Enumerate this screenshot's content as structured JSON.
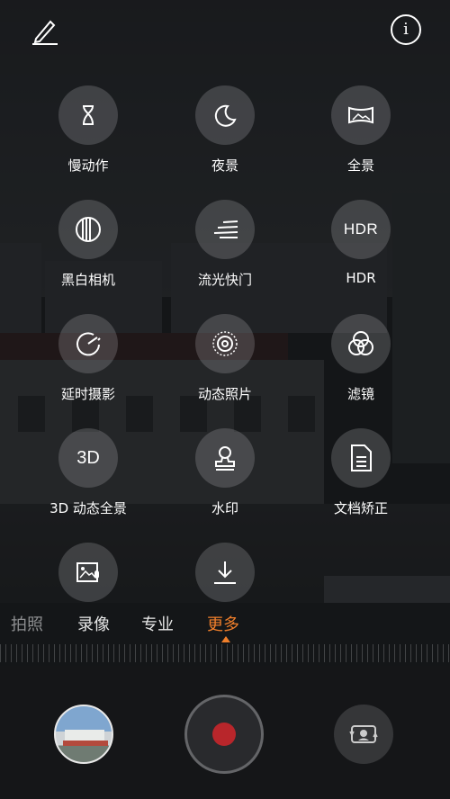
{
  "modes": [
    {
      "label": "慢动作",
      "icon": "hourglass-icon"
    },
    {
      "label": "夜景",
      "icon": "moon-icon"
    },
    {
      "label": "全景",
      "icon": "panorama-icon"
    },
    {
      "label": "黑白相机",
      "icon": "monochrome-icon"
    },
    {
      "label": "流光快门",
      "icon": "light-trail-icon"
    },
    {
      "label": "HDR",
      "icon": "hdr-icon",
      "icon_text": "HDR"
    },
    {
      "label": "延时摄影",
      "icon": "timelapse-icon"
    },
    {
      "label": "动态照片",
      "icon": "moving-picture-icon"
    },
    {
      "label": "滤镜",
      "icon": "filter-icon"
    },
    {
      "label": "3D 动态全景",
      "icon": "3d-panorama-icon",
      "icon_text": "3D"
    },
    {
      "label": "水印",
      "icon": "watermark-icon"
    },
    {
      "label": "文档矫正",
      "icon": "document-correction-icon"
    },
    {
      "label": "",
      "icon": "audio-note-icon"
    },
    {
      "label": "",
      "icon": "download-icon"
    }
  ],
  "tabs": [
    {
      "label": "拍照",
      "state": "dim"
    },
    {
      "label": "录像",
      "state": "normal"
    },
    {
      "label": "专业",
      "state": "normal"
    },
    {
      "label": "更多",
      "state": "active"
    }
  ],
  "colors": {
    "accent": "#f07f2b",
    "record": "#b8262b"
  }
}
